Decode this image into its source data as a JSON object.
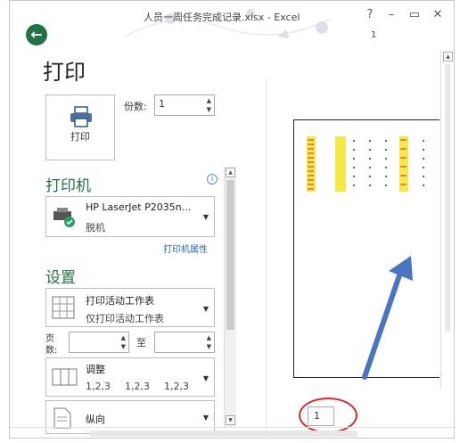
{
  "window": {
    "title": "人员一周任务完成记录.xlsx - Excel",
    "help": "?",
    "minimize": "–",
    "maximize": "▭",
    "close": "✕",
    "ribbon_counter": "1"
  },
  "backstage": {
    "back_glyph": "←",
    "heading": "打印"
  },
  "print": {
    "button_label": "打印",
    "copies_label": "份数:",
    "copies_value": "1"
  },
  "printer": {
    "section": "打印机",
    "name": "HP LaserJet P2035n...",
    "status": "脱机",
    "properties_link": "打印机属性",
    "info_glyph": "i"
  },
  "settings": {
    "section": "设置",
    "scope": {
      "title": "打印活动工作表",
      "subtitle": "仅打印活动工作表"
    },
    "pages_label_1": "页",
    "pages_label_2": "数:",
    "pages_to": "至",
    "collate": {
      "title": "调整",
      "options": [
        "1,2,3",
        "1,2,3",
        "1,2,3"
      ]
    },
    "orientation": {
      "title": "纵向"
    }
  },
  "preview": {
    "page_number": "1"
  },
  "colors": {
    "accent": "#217346",
    "highlight": "#f7e84a",
    "annotation_red": "#d9272e",
    "arrow_blue": "#4a76c1"
  }
}
